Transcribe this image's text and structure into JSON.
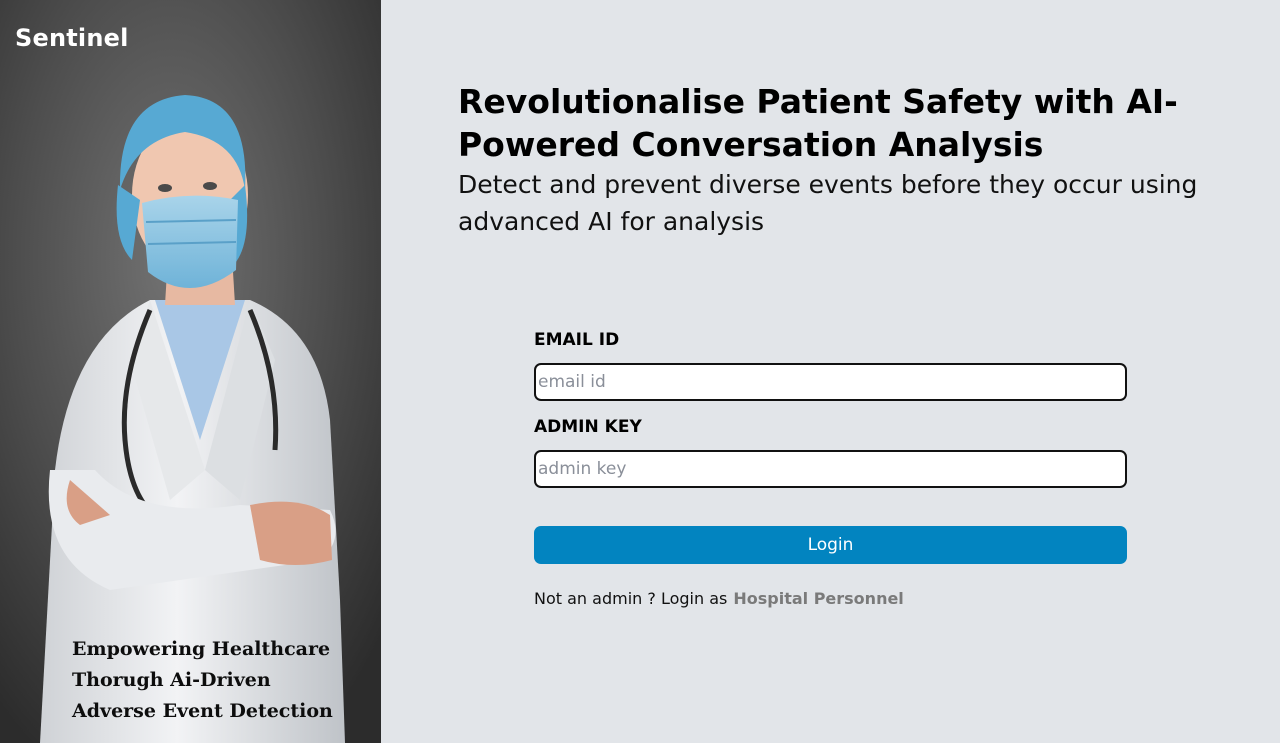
{
  "brand": {
    "name": "Sentinel"
  },
  "hero": {
    "image_description_icon": "doctor-photo",
    "tagline": [
      "Empowering Healthcare",
      "Thorugh Ai-Driven",
      "Adverse Event Detection"
    ]
  },
  "main": {
    "headline": "Revolutionalise Patient Safety with AI-Powered Conversation Analysis",
    "subheadline": "Detect and prevent diverse events before they occur using advanced AI for analysis"
  },
  "form": {
    "email": {
      "label": "EMAIL ID",
      "placeholder": "email id",
      "value": ""
    },
    "admin_key": {
      "label": "ADMIN KEY",
      "placeholder": "admin key",
      "value": ""
    },
    "login_button": "Login",
    "alt_prompt": "Not an admin ? Login as",
    "alt_link": "Hospital Personnel"
  },
  "colors": {
    "page_bg": "#e2e5e9",
    "button_bg": "#0284c0",
    "link_color": "#7a7a7a"
  }
}
